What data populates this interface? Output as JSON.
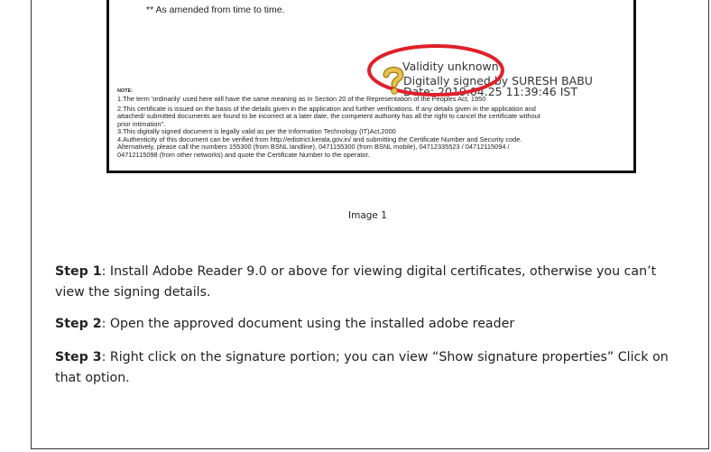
{
  "certificate": {
    "amended_text": "** As amended from time to time.",
    "note_label": "NOTE:",
    "notes": [
      "1.The term 'ordinarily' used here will have the same meaning as in Section 20 of the Representation of the Peoples Act, 1950",
      "2.This certificate is issued on the basis of the details given in the application and further verifications. If any details given in the application and",
      "attached/ submitted documents are found to be incorrect at a later date, the competent authority has all the right to cancel the certificate without",
      "prior intimation\".",
      "3.This digitally signed document is legally valid as per the Information Technology (IT)Act,2000",
      "4.Authenticity of this document can be verified from http://edistrict.kerala.gov.in/ and submitting the Certificate Number and Security code.",
      "Alternatively, please call the numbers 155300 (from BSNL landline), 0471155300 (from BSNL mobile), 04712335523 / 04712115094 /",
      "04712115098 (from other networks) and quote the Certificate Number to the operator."
    ],
    "signature": {
      "validity": "Validity unknown",
      "signed_by": "Digitally signed by SURESH BABU",
      "date": "Date: 2019.04.25 11:39:46 IST"
    }
  },
  "caption": "Image 1",
  "steps": [
    {
      "label": "Step 1",
      "text": ": Install Adobe Reader 9.0 or above for viewing digital certificates, otherwise you can’t view the signing details."
    },
    {
      "label": "Step 2",
      "text": ": Open the approved document using the installed adobe reader"
    },
    {
      "label": "Step 3",
      "text": ": Right click on the signature portion; you can view “Show signature properties” Click on that option."
    }
  ],
  "colors": {
    "oval": "#e0202a",
    "qmark": "#e8c24a"
  }
}
